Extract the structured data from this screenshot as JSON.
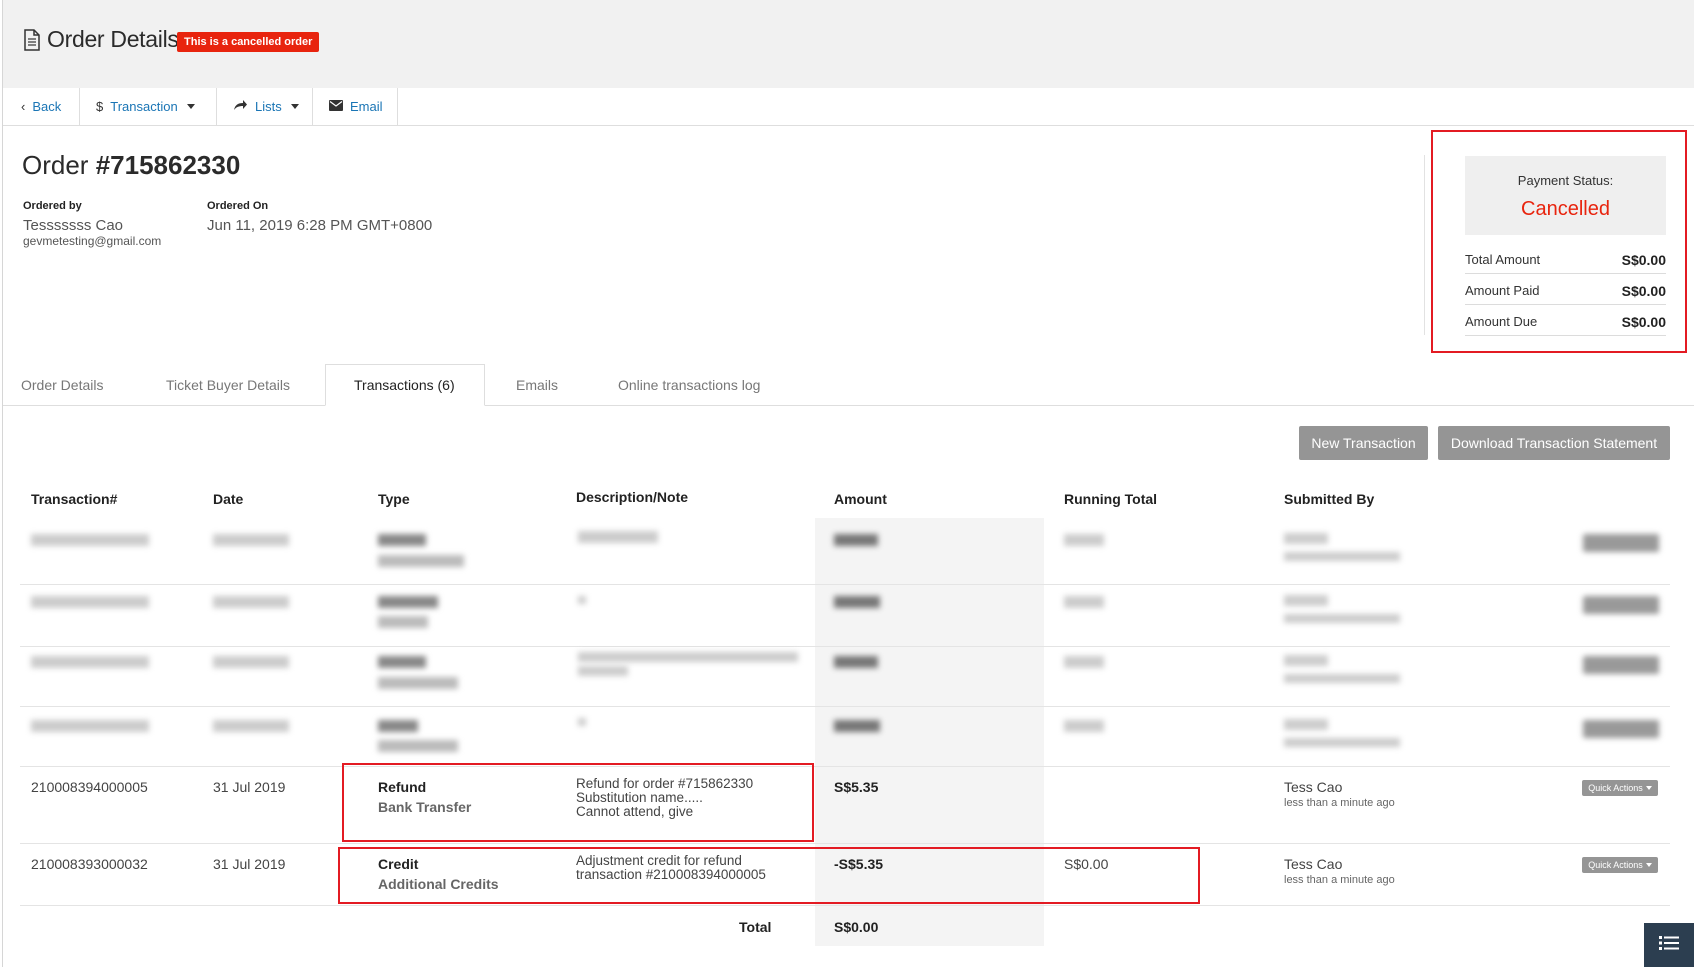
{
  "header": {
    "title": "Order Details",
    "badge": "This is a cancelled order",
    "title_icon": "document-icon"
  },
  "toolbar": {
    "back": "Back",
    "transaction": "Transaction",
    "lists": "Lists",
    "email": "Email"
  },
  "order": {
    "title_prefix": "Order",
    "number": "#715862330",
    "ordered_by_label": "Ordered by",
    "ordered_by_name": "Tesssssss Cao",
    "ordered_by_email": "gevmetesting@gmail.com",
    "ordered_on_label": "Ordered On",
    "ordered_on_value": "Jun 11, 2019 6:28 PM GMT+0800"
  },
  "payment": {
    "status_label": "Payment Status:",
    "status_value": "Cancelled",
    "status_color": "#e8240e",
    "rows": [
      {
        "label": "Total Amount",
        "value": "S$0.00"
      },
      {
        "label": "Amount Paid",
        "value": "S$0.00"
      },
      {
        "label": "Amount Due",
        "value": "S$0.00"
      }
    ]
  },
  "tabs": [
    {
      "label": "Order Details"
    },
    {
      "label": "Ticket Buyer Details"
    },
    {
      "label": "Transactions (6)",
      "active": true
    },
    {
      "label": "Emails"
    },
    {
      "label": "Online transactions log"
    }
  ],
  "actions": {
    "new_transaction": "New Transaction",
    "download_statement": "Download Transaction Statement"
  },
  "table": {
    "headers": [
      "Transaction#",
      "Date",
      "Type",
      "Description/Note",
      "Amount",
      "Running Total",
      "Submitted By"
    ],
    "rows": [
      {
        "transaction": "210008394000005",
        "date": "31 Jul 2019",
        "type": "Refund",
        "subtype": "Bank Transfer",
        "description": [
          "Refund for order #715862330",
          "Substitution name.....",
          "Cannot attend, give"
        ],
        "amount": "S$5.35",
        "running_total": "",
        "submitted_by": "Tess Cao",
        "submitted_when": "less than a minute ago",
        "quick_actions": "Quick Actions"
      },
      {
        "transaction": "210008393000032",
        "date": "31 Jul 2019",
        "type": "Credit",
        "subtype": "Additional Credits",
        "description": [
          "Adjustment credit for refund",
          "transaction #210008394000005"
        ],
        "amount": "-S$5.35",
        "running_total": "S$0.00",
        "submitted_by": "Tess Cao",
        "submitted_when": "less than a minute ago",
        "quick_actions": "Quick Actions"
      }
    ],
    "total_label": "Total",
    "total_value": "S$0.00"
  },
  "colors": {
    "accent_link": "#1a75b5",
    "badge_red": "#e8240e",
    "annotation_red": "#e31b23",
    "button_gray": "#959595"
  }
}
